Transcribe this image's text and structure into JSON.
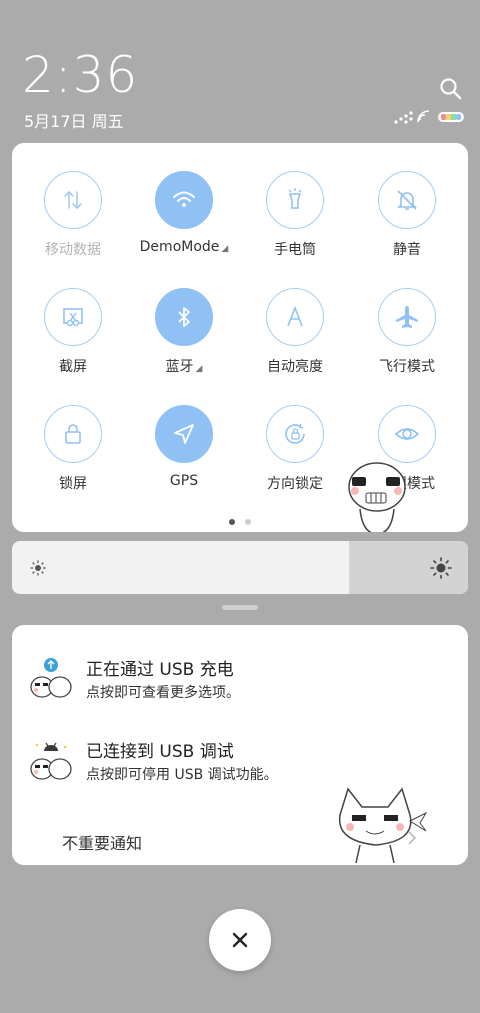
{
  "status": {
    "time": "2:36",
    "date": "5月17日 周五"
  },
  "quick_settings": {
    "tiles": [
      {
        "label": "移动数据",
        "icon": "mobile-data-icon",
        "active": false,
        "dim": true,
        "has_more": false
      },
      {
        "label": "DemoMode",
        "icon": "wifi-icon",
        "active": true,
        "dim": false,
        "has_more": true
      },
      {
        "label": "手电筒",
        "icon": "flashlight-icon",
        "active": false,
        "dim": false,
        "has_more": false
      },
      {
        "label": "静音",
        "icon": "mute-bell-icon",
        "active": false,
        "dim": false,
        "has_more": false
      },
      {
        "label": "截屏",
        "icon": "screenshot-icon",
        "active": false,
        "dim": false,
        "has_more": false
      },
      {
        "label": "蓝牙",
        "icon": "bluetooth-icon",
        "active": true,
        "dim": false,
        "has_more": true
      },
      {
        "label": "自动亮度",
        "icon": "auto-brightness-icon",
        "active": false,
        "dim": false,
        "has_more": false
      },
      {
        "label": "飞行模式",
        "icon": "airplane-icon",
        "active": false,
        "dim": false,
        "has_more": false
      },
      {
        "label": "锁屏",
        "icon": "lock-icon",
        "active": false,
        "dim": false,
        "has_more": false
      },
      {
        "label": "GPS",
        "icon": "gps-icon",
        "active": true,
        "dim": false,
        "has_more": false
      },
      {
        "label": "方向锁定",
        "icon": "rotation-lock-icon",
        "active": false,
        "dim": false,
        "has_more": false
      },
      {
        "label": "护眼模式",
        "icon": "eye-icon",
        "active": false,
        "dim": false,
        "has_more": false
      }
    ],
    "page_count": 2,
    "current_page": 1
  },
  "brightness": {
    "level": 0.74
  },
  "notifications": [
    {
      "title": "正在通过 USB 充电",
      "subtitle": "点按即可查看更多选项。",
      "icon": "usb-icon"
    },
    {
      "title": "已连接到 USB 调试",
      "subtitle": "点按即可停用 USB 调试功能。",
      "icon": "android-icon"
    }
  ],
  "less_important_label": "不重要通知",
  "colors": {
    "accent": "#8fc1f5",
    "tile_border": "#a6cdf2"
  }
}
